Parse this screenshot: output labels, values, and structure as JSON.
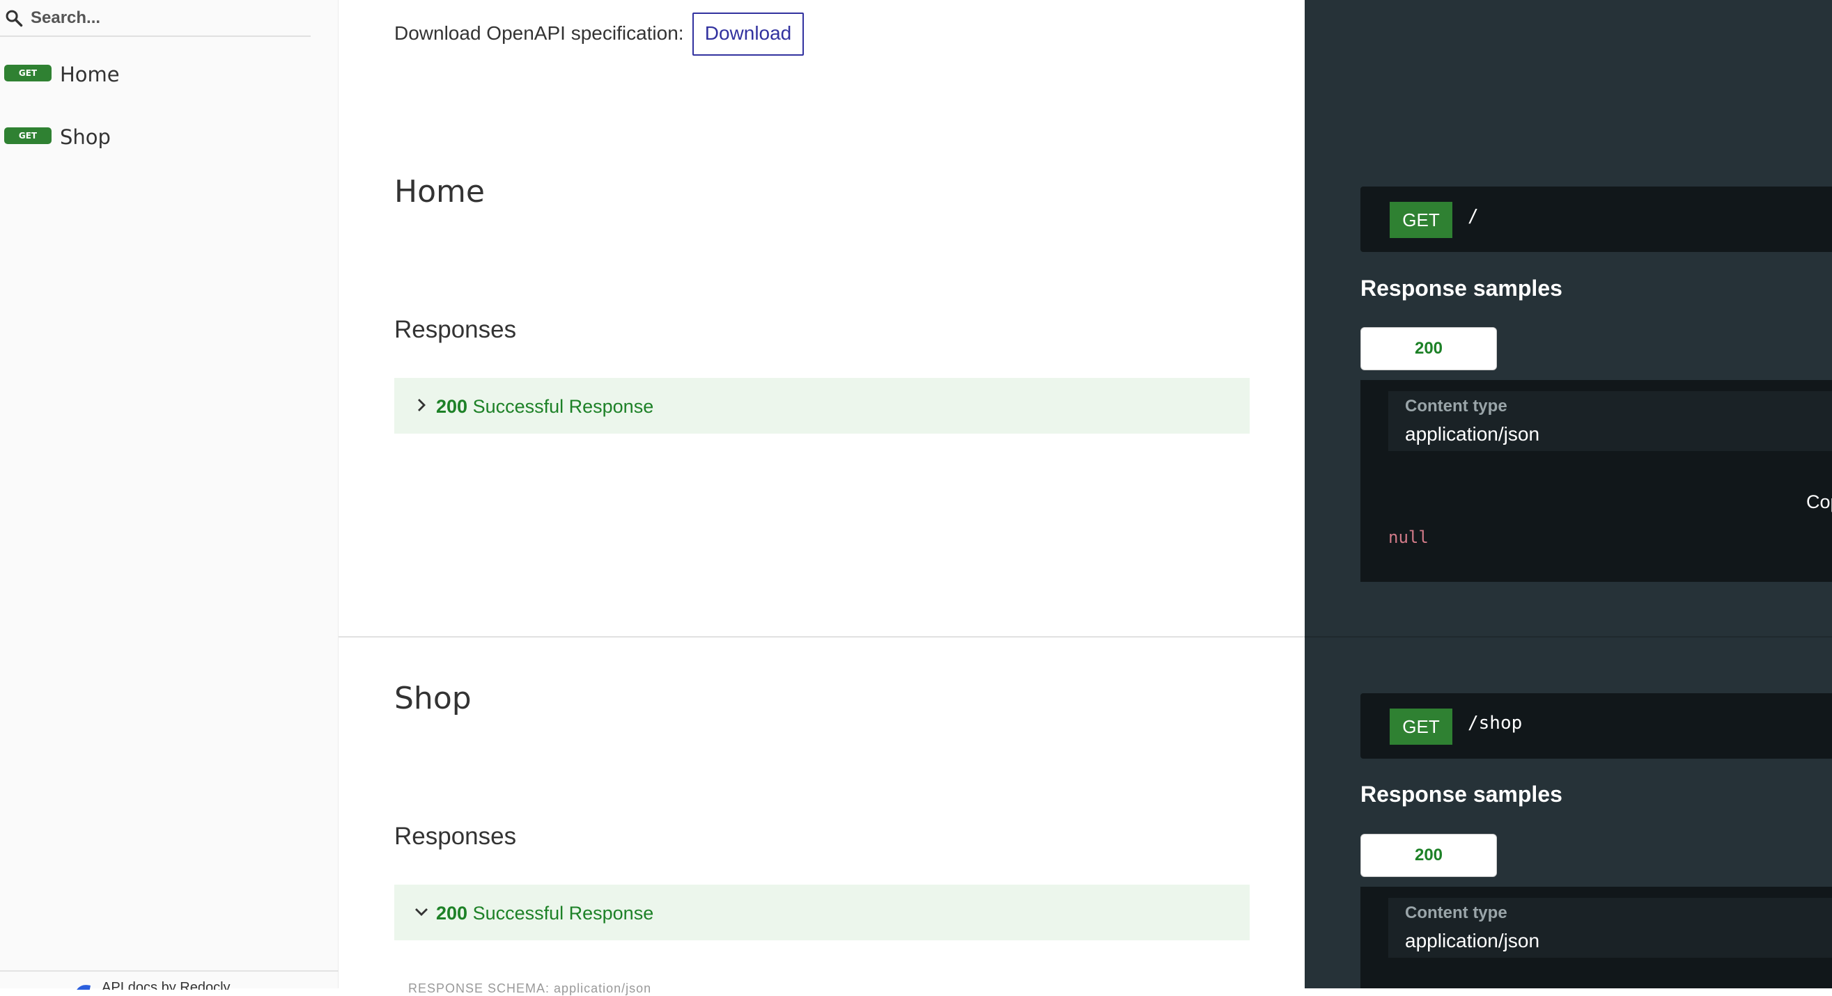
{
  "search": {
    "placeholder": "Search..."
  },
  "sidebar": {
    "items": [
      {
        "method": "GET",
        "label": "Home"
      },
      {
        "method": "GET",
        "label": "Shop"
      }
    ],
    "footer": {
      "text": "API docs by Redocly"
    }
  },
  "header": {
    "download_label": "Download OpenAPI specification:",
    "download_button": "Download"
  },
  "operations": [
    {
      "title": "Home",
      "responses_heading": "Responses",
      "response": {
        "code": "200",
        "description": "Successful Response",
        "expanded": false
      },
      "method": "GET",
      "path": "/",
      "samples_heading": "Response samples",
      "tab": "200",
      "content_type_label": "Content type",
      "content_type": "application/json",
      "copy_label": "Copy",
      "sample_value": "null"
    },
    {
      "title": "Shop",
      "responses_heading": "Responses",
      "response": {
        "code": "200",
        "description": "Successful Response",
        "expanded": true
      },
      "response_schema_caption": "RESPONSE SCHEMA: application/json",
      "method": "GET",
      "path": "/shop",
      "samples_heading": "Response samples",
      "tab": "200",
      "content_type_label": "Content type",
      "content_type": "application/json"
    }
  ],
  "colors": {
    "get_badge": "#2f8132",
    "response_green": "#1d8127",
    "download_blue": "#32329f",
    "right_panel": "#263238",
    "code_bg": "#11171a"
  },
  "icons": {
    "search": "search-icon",
    "collapsed": "chevron-right-icon",
    "expanded": "chevron-down-icon"
  }
}
